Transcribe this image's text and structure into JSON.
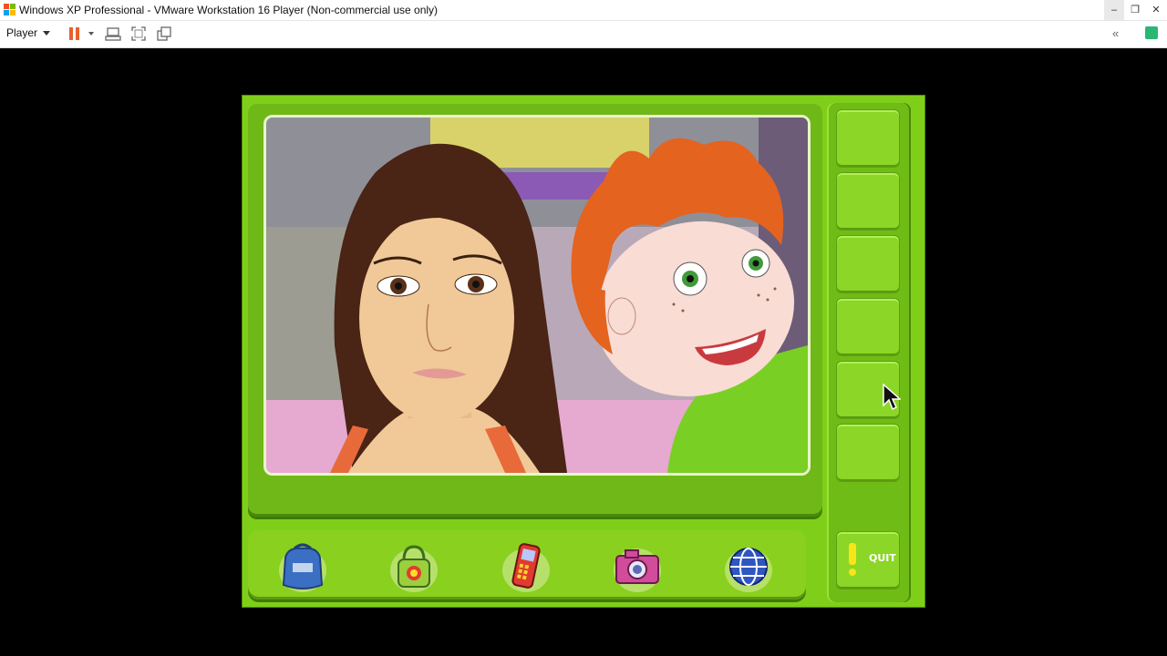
{
  "window": {
    "title": "Windows XP Professional - VMware Workstation 16 Player (Non-commercial use only)",
    "controls": [
      "minimize",
      "restore",
      "close"
    ]
  },
  "toolbar": {
    "player_menu": "Player",
    "icons": [
      "pause-icon",
      "send-ctrl-alt-del-icon",
      "fullscreen-icon",
      "unity-icon"
    ]
  },
  "game": {
    "tools": [
      {
        "name": "backpack"
      },
      {
        "name": "locket"
      },
      {
        "name": "cell-phone"
      },
      {
        "name": "camera"
      },
      {
        "name": "globe"
      }
    ],
    "sidebar_slots": 6,
    "quit_label": "QUIT"
  },
  "colors": {
    "game_green": "#7fcf1a",
    "pause_orange": "#e8612c",
    "quit_yellow": "#f7e51a"
  }
}
